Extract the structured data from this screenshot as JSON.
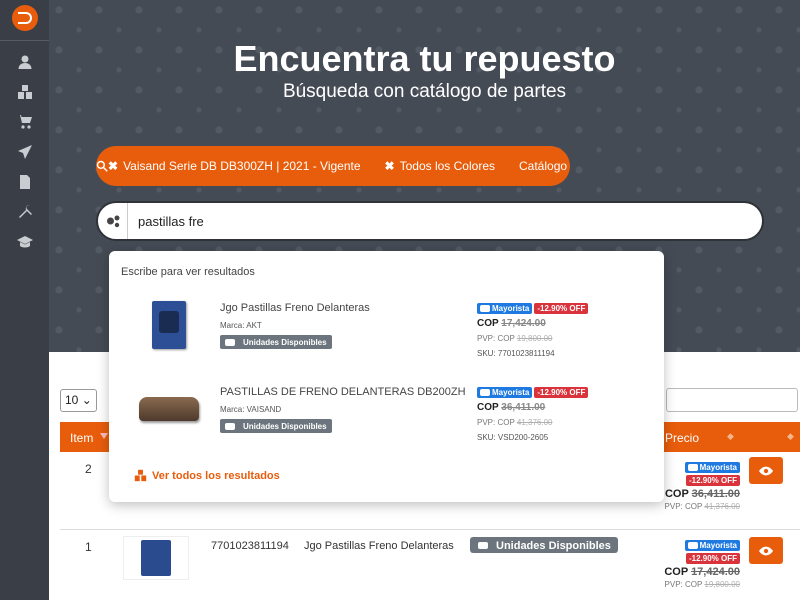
{
  "sidebar": {
    "items": [
      {
        "icon": "user-icon"
      },
      {
        "icon": "boxes-icon"
      },
      {
        "icon": "cart-icon"
      },
      {
        "icon": "send-icon"
      },
      {
        "icon": "document-icon"
      },
      {
        "icon": "tools-icon"
      },
      {
        "icon": "graduation-cap-icon"
      }
    ]
  },
  "hero": {
    "title": "Encuentra tu repuesto",
    "subtitle": "Búsqueda con catálogo de partes"
  },
  "filters": {
    "vehicle": "Vaisand Serie DB DB300ZH | 2021 - Vigente",
    "color": "Todos los Colores",
    "catalog": "Catálogo",
    "remove_symbol": "✖"
  },
  "search": {
    "value": "pastillas fre"
  },
  "dropdown": {
    "hint": "Escribe para ver resultados",
    "results": [
      {
        "name": "Jgo Pastillas Freno Delanteras",
        "brand": "Marca: AKT",
        "availability": "Unidades Disponibles",
        "badge_wholesale": "Mayorista",
        "badge_off": "-12.90% OFF",
        "price": "COP 17,424.00",
        "price_prefix": "COP",
        "price_value": "17,424.00",
        "pvp_prefix": "PVP: COP",
        "pvp_value": "19,800.00",
        "sku": "SKU: 7701023811194"
      },
      {
        "name": "PASTILLAS DE FRENO DELANTERAS DB200ZH",
        "brand": "Marca: VAISAND",
        "availability": "Unidades Disponibles",
        "badge_wholesale": "Mayorista",
        "badge_off": "-12.90% OFF",
        "price_prefix": "COP",
        "price_value": "36,411.00",
        "pvp_prefix": "PVP: COP",
        "pvp_value": "41,376.00",
        "sku": "SKU: VSD200-2605"
      }
    ],
    "see_all": "Ver todos los resultados"
  },
  "table": {
    "page_size": "10",
    "headers": {
      "item": "Item",
      "price": "Precio"
    },
    "rows": [
      {
        "item": "2",
        "badge_wholesale": "Mayorista",
        "badge_off": "-12.90% OFF",
        "price_prefix": "COP",
        "price_value": "36,411.00",
        "pvp_prefix": "PVP: COP",
        "pvp_value": "41,376.00"
      },
      {
        "item": "1",
        "sku": "7701023811194",
        "name": "Jgo Pastillas Freno Delanteras",
        "availability": "Unidades Disponibles",
        "badge_wholesale": "Mayorista",
        "badge_off": "-12.90% OFF",
        "price_prefix": "COP",
        "price_value": "17,424.00",
        "pvp_prefix": "PVP: COP",
        "pvp_value": "19,800.00"
      }
    ]
  },
  "colors": {
    "accent": "#e85d0c",
    "sidebar": "#3a3f47",
    "hero": "#454b55",
    "wholesale_badge": "#1e7ae0",
    "off_badge": "#d9343c",
    "availability_badge": "#6c757d"
  }
}
